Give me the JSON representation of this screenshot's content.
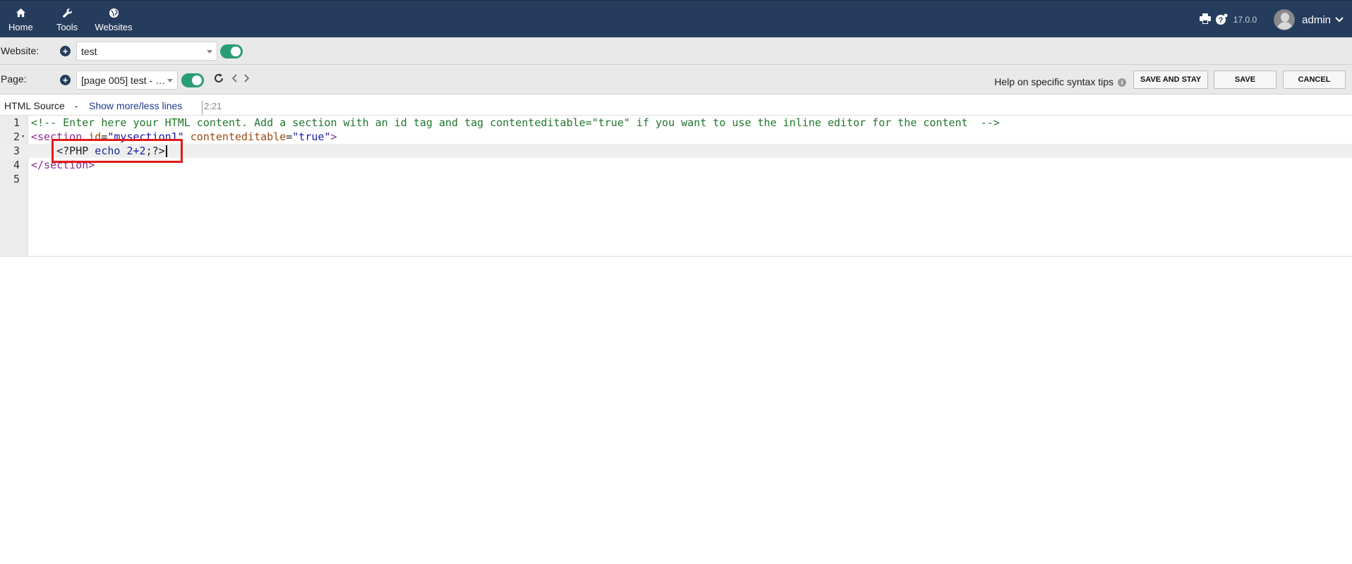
{
  "nav": {
    "items": [
      {
        "label": "Home",
        "icon": "home-icon"
      },
      {
        "label": "Tools",
        "icon": "wrench-icon"
      },
      {
        "label": "Websites",
        "icon": "globe-icon"
      }
    ],
    "version": "17.0.0",
    "user": "admin"
  },
  "website_row": {
    "label": "Website:",
    "selected": "test"
  },
  "page_row": {
    "label": "Page:",
    "selected": "[page 005] test - …",
    "help_text": "Help on specific syntax tips",
    "buttons": {
      "save_and_stay": "SAVE AND STAY",
      "save": "SAVE",
      "cancel": "CANCEL"
    }
  },
  "editor_header": {
    "title": "HTML Source",
    "separator": "-",
    "toggle_link": "Show more/less lines",
    "cursor_pos": "2:21"
  },
  "editor": {
    "line_numbers": [
      "1",
      "2",
      "3",
      "4",
      "5"
    ],
    "lines": {
      "l1": "<!-- Enter here your HTML content. Add a section with an id tag and tag contenteditable=\"true\" if you want to use the inline editor for the content  -->",
      "l2_tag_open": "<section",
      "l2_attr1": " id",
      "l2_eq1": "=",
      "l2_val1": "\"mysection1\"",
      "l2_attr2": " contenteditable",
      "l2_eq2": "=",
      "l2_val2": "\"true\"",
      "l2_close": ">",
      "l3_indent": "    ",
      "l3_php_open": "<?PHP",
      "l3_echo": " echo",
      "l3_expr": " 2+2",
      "l3_rest": ";?>",
      "l4": "</section>",
      "l5": ""
    }
  },
  "colors": {
    "topbar": "#263c5c",
    "toggle": "#2a9d74",
    "highlight_box": "#e11b1b"
  }
}
